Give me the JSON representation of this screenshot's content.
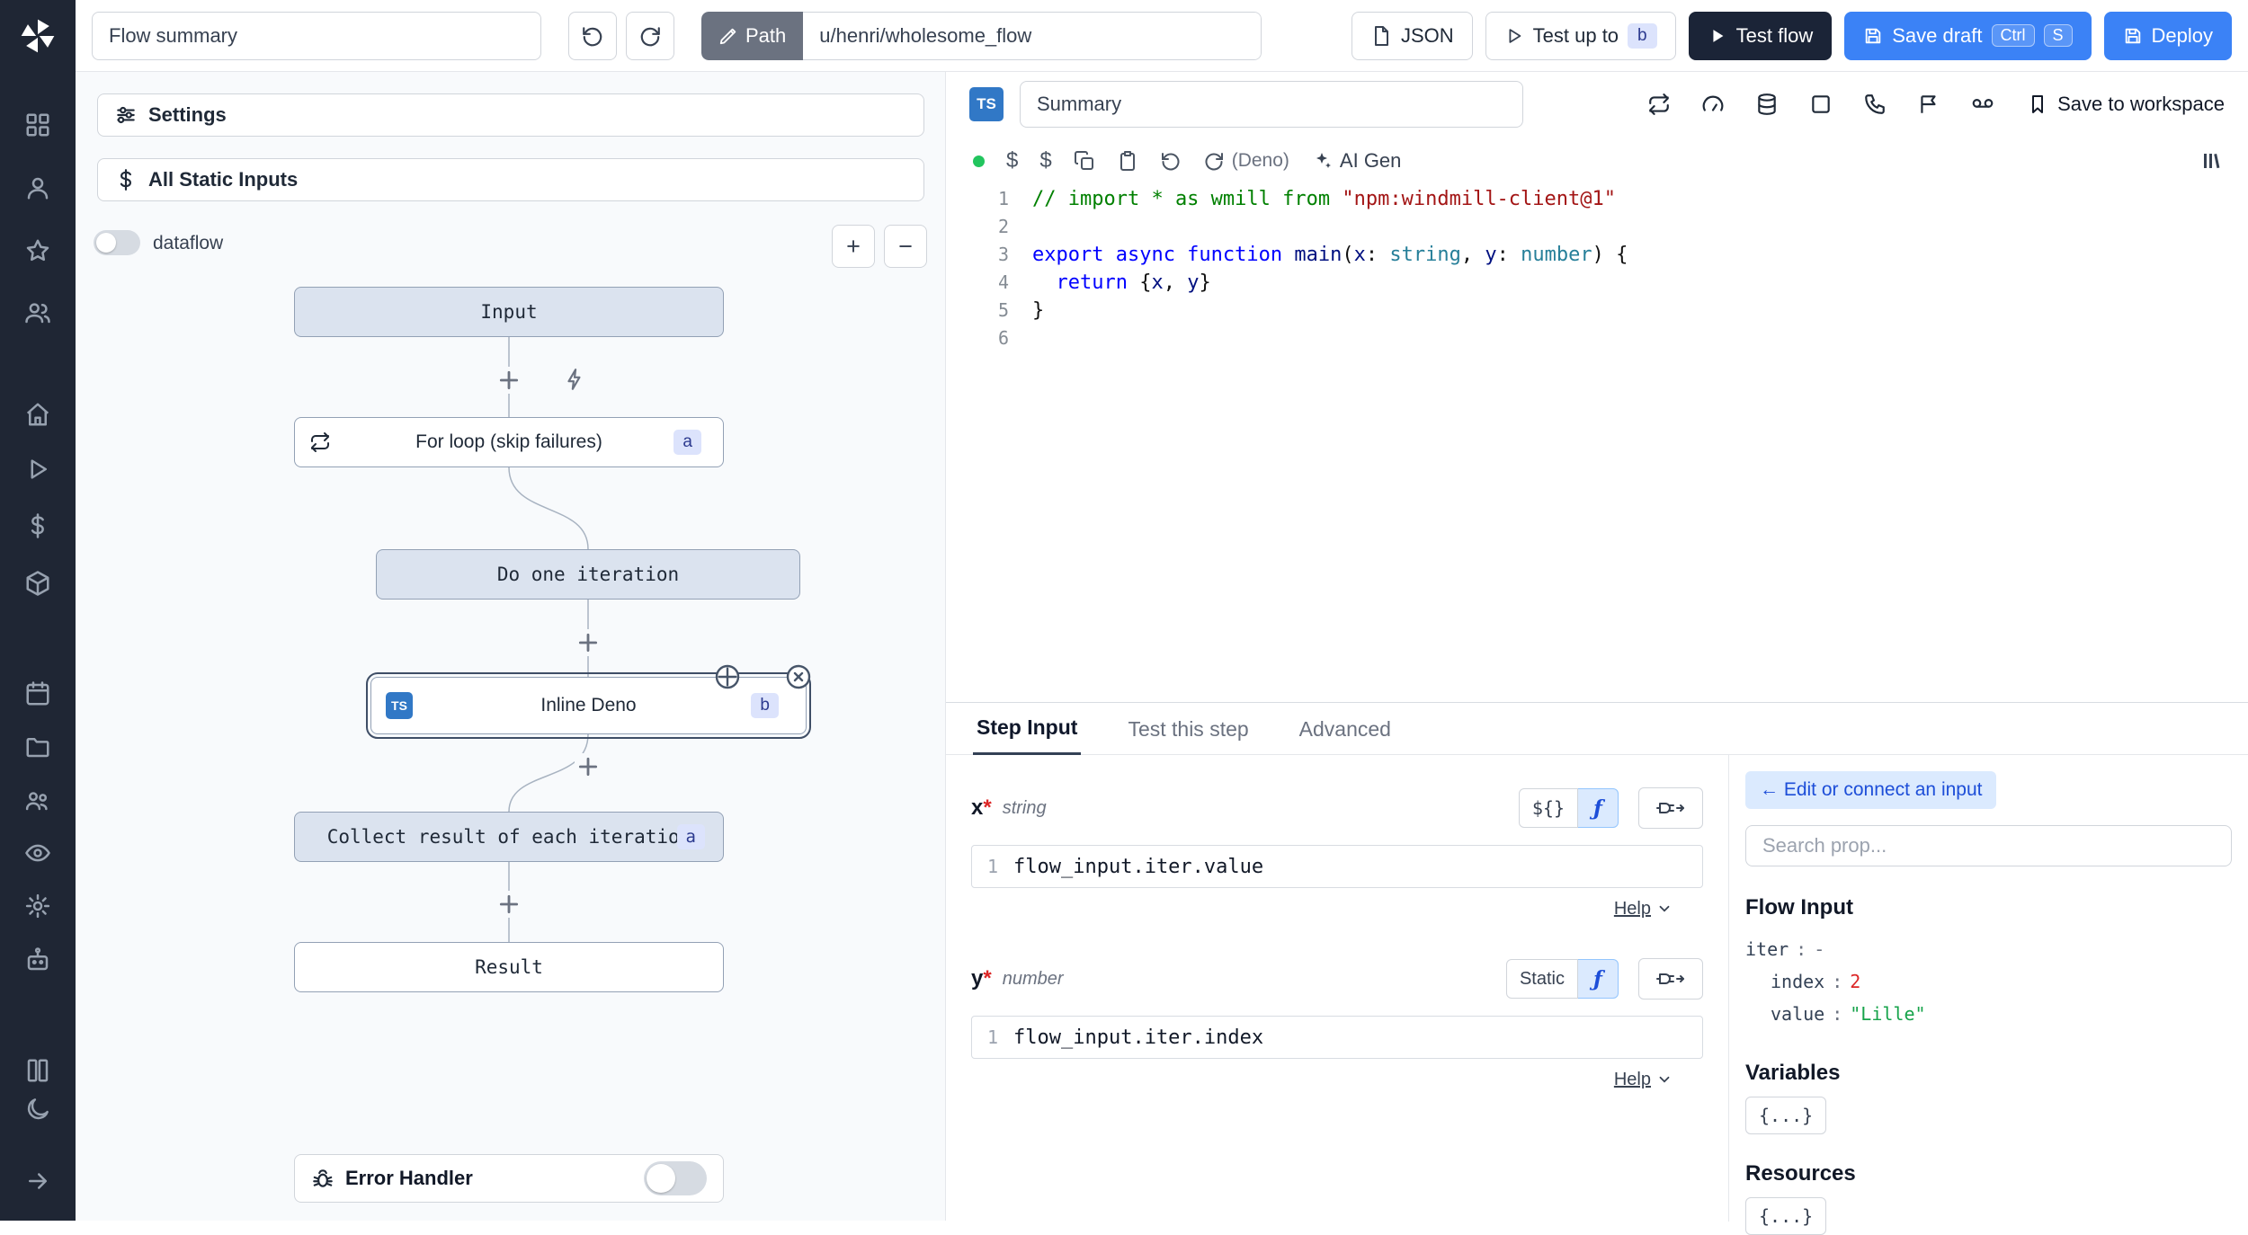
{
  "topbar": {
    "flow_summary": "Flow summary",
    "path_label": "Path",
    "path_value": "u/henri/wholesome_flow",
    "json": "JSON",
    "test_up_to": "Test up to",
    "test_up_to_badge": "b",
    "test_flow": "Test flow",
    "save_draft": "Save draft",
    "kbd_ctrl": "Ctrl",
    "kbd_s": "S",
    "deploy": "Deploy"
  },
  "flow": {
    "settings": "Settings",
    "static_inputs": "All Static Inputs",
    "dataflow": "dataflow",
    "zoom_in": "+",
    "zoom_out": "−",
    "nodes": {
      "input": "Input",
      "forloop": "For loop (skip failures)",
      "forloop_badge": "a",
      "iteration": "Do one iteration",
      "inline": "Inline Deno",
      "inline_badge": "b",
      "inline_lang": "TS",
      "collect": "Collect result of each iteration",
      "collect_badge": "a",
      "result": "Result"
    },
    "error_handler": "Error Handler"
  },
  "editor": {
    "lang_badge": "TS",
    "summary": "Summary",
    "save_to_workspace": "Save to workspace",
    "dollar1": "$",
    "dollar2": "$",
    "deno": "(Deno)",
    "ai_gen": "AI Gen",
    "lines": {
      "l1": {
        "n": "1",
        "c": "// import * as wmill from ",
        "s": "\"npm:windmill-client@1\""
      },
      "l2": {
        "n": "2"
      },
      "l3": {
        "n": "3",
        "k": "export async function ",
        "fn": "main",
        "p1": "(",
        "v1": "x",
        "c1": ": ",
        "t1": "string",
        "p2": ", ",
        "v2": "y",
        "c2": ": ",
        "t2": "number",
        "p3": ") {"
      },
      "l4": {
        "n": "4",
        "i": "  ",
        "k": "return",
        "p1": " {",
        "v1": "x",
        "p2": ", ",
        "v2": "y",
        "p3": "}"
      },
      "l5": {
        "n": "5",
        "p1": "}"
      },
      "l6": {
        "n": "6"
      }
    }
  },
  "step": {
    "tab_step_input": "Step Input",
    "tab_test_step": "Test this step",
    "tab_advanced": "Advanced",
    "x_name": "x",
    "x_req": "*",
    "x_type": "string",
    "x_expr_btn": "${}",
    "x_line": "1",
    "x_value": "flow_input.iter.value",
    "x_help": "Help",
    "y_name": "y",
    "y_req": "*",
    "y_type": "number",
    "y_mode_btn": "Static",
    "y_line": "1",
    "y_value": "flow_input.iter.index",
    "y_help": "Help",
    "fx_icon": "ƒ"
  },
  "props": {
    "edit_connect": "← Edit or connect an input",
    "search_placeholder": "Search prop...",
    "flow_input": "Flow Input",
    "iter_key": "iter",
    "iter_sep": ":",
    "iter_val": "-",
    "index_key": "index",
    "index_sep": ":",
    "index_val": "2",
    "value_key": "value",
    "value_sep": ":",
    "value_val": "\"Lille\"",
    "variables": "Variables",
    "variables_btn": "{...}",
    "resources": "Resources",
    "resources_btn": "{...}"
  }
}
